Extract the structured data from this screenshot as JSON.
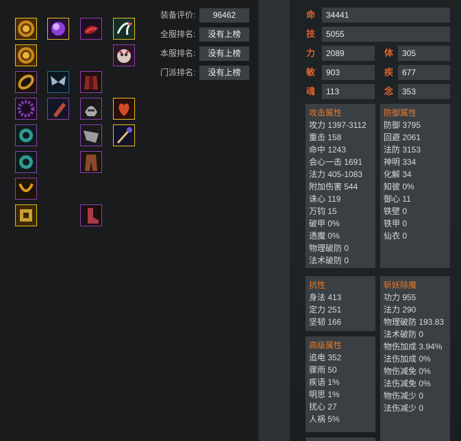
{
  "rankings": [
    {
      "label": "装备评价:",
      "value": "96462"
    },
    {
      "label": "全服排名:",
      "value": "没有上榜"
    },
    {
      "label": "本服排名:",
      "value": "没有上榜"
    },
    {
      "label": "门派排名:",
      "value": "没有上榜"
    }
  ],
  "equipment_icons": [
    "coin-emblem-icon",
    "purple-orb-icon",
    "red-scarf-icon",
    "white-crane-icon",
    "coin-emblem-icon",
    "fox-pet-icon",
    "gold-belt-icon",
    "butterfly-wings-icon",
    "red-armor-icon",
    "purple-bead-ring-icon",
    "red-bracer-icon",
    "silver-helmet-icon",
    "red-amulet-icon",
    "jade-ring-icon",
    "silver-shoulder-icon",
    "gold-staff-icon",
    "jade-ring-icon",
    "brown-pants-icon",
    "gold-necklace-icon",
    "gold-rune-icon",
    "red-boots-icon"
  ],
  "main_stats": {
    "hp": {
      "label": "命",
      "value": "34441"
    },
    "skill": {
      "label": "技",
      "value": "5055"
    },
    "str": {
      "label": "力",
      "value": "2089"
    },
    "con": {
      "label": "体",
      "value": "305"
    },
    "agi": {
      "label": "敏",
      "value": "903"
    },
    "spd": {
      "label": "疾",
      "value": "677"
    },
    "soul": {
      "label": "魂",
      "value": "113"
    },
    "mind": {
      "label": "念",
      "value": "353"
    }
  },
  "attack": {
    "title": "攻击属性",
    "rows": [
      "攻力 1397-3112",
      "重击 158",
      "命中 1243",
      "会心一击 1691",
      "法力 405-1083",
      "附加伤害 544",
      "诛心 119",
      "万钧 15",
      "破甲 0%",
      "透魔 0%",
      "物理破防 0",
      "法术破防 0"
    ]
  },
  "defense": {
    "title": "防御属性",
    "rows": [
      "防御 3795",
      "回避 2061",
      "法防 3153",
      "神明 334",
      "化解 34",
      "知彼 0%",
      "御心 11",
      "铁壁 0",
      "铁甲 0",
      "仙衣 0"
    ]
  },
  "resist": {
    "title": "抗性",
    "rows": [
      "身法 413",
      "定力 251",
      "坚韧 166"
    ]
  },
  "advanced": {
    "title": "高级属性",
    "rows": [
      "追电 352",
      "骤雨 50",
      "疾语 1%",
      "明思 1%",
      "扰心 27",
      "人祸 5%"
    ]
  },
  "demon": {
    "title": "斩妖除魔",
    "rows": [
      "功力 955",
      "法力 290",
      "物理破防 193.83",
      "法术破防 0",
      "物伤加成 3.94%",
      "法伤加成 0%",
      "物伤减免 0%",
      "法伤减免 0%",
      "物伤减少 0",
      "法伤减少 0"
    ]
  }
}
